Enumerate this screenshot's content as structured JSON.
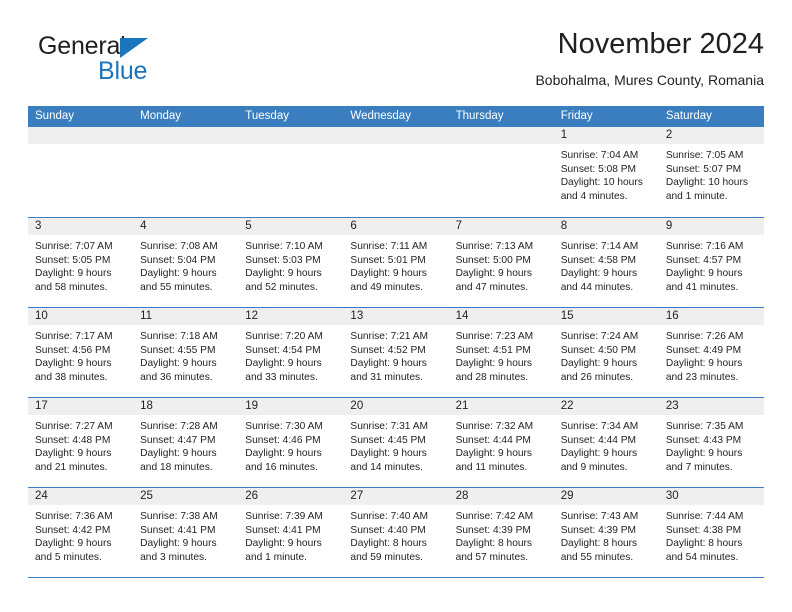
{
  "brand": {
    "word_one": "General",
    "word_two": "Blue",
    "triangle_icon": "triangle-icon",
    "accent_color": "#1b75bb"
  },
  "header": {
    "title": "November 2024",
    "subtitle": "Bobohalma, Mures County, Romania"
  },
  "theme": {
    "header_blue": "#3a7ebf",
    "day_number_band": "#efefef",
    "text_color": "#231f20"
  },
  "calendar": {
    "weekday_headers": [
      "Sunday",
      "Monday",
      "Tuesday",
      "Wednesday",
      "Thursday",
      "Friday",
      "Saturday"
    ],
    "weeks": [
      [
        {
          "day": "",
          "lines": []
        },
        {
          "day": "",
          "lines": []
        },
        {
          "day": "",
          "lines": []
        },
        {
          "day": "",
          "lines": []
        },
        {
          "day": "",
          "lines": []
        },
        {
          "day": "1",
          "lines": [
            "Sunrise: 7:04 AM",
            "Sunset: 5:08 PM",
            "Daylight: 10 hours",
            "and 4 minutes."
          ]
        },
        {
          "day": "2",
          "lines": [
            "Sunrise: 7:05 AM",
            "Sunset: 5:07 PM",
            "Daylight: 10 hours",
            "and 1 minute."
          ]
        }
      ],
      [
        {
          "day": "3",
          "lines": [
            "Sunrise: 7:07 AM",
            "Sunset: 5:05 PM",
            "Daylight: 9 hours",
            "and 58 minutes."
          ]
        },
        {
          "day": "4",
          "lines": [
            "Sunrise: 7:08 AM",
            "Sunset: 5:04 PM",
            "Daylight: 9 hours",
            "and 55 minutes."
          ]
        },
        {
          "day": "5",
          "lines": [
            "Sunrise: 7:10 AM",
            "Sunset: 5:03 PM",
            "Daylight: 9 hours",
            "and 52 minutes."
          ]
        },
        {
          "day": "6",
          "lines": [
            "Sunrise: 7:11 AM",
            "Sunset: 5:01 PM",
            "Daylight: 9 hours",
            "and 49 minutes."
          ]
        },
        {
          "day": "7",
          "lines": [
            "Sunrise: 7:13 AM",
            "Sunset: 5:00 PM",
            "Daylight: 9 hours",
            "and 47 minutes."
          ]
        },
        {
          "day": "8",
          "lines": [
            "Sunrise: 7:14 AM",
            "Sunset: 4:58 PM",
            "Daylight: 9 hours",
            "and 44 minutes."
          ]
        },
        {
          "day": "9",
          "lines": [
            "Sunrise: 7:16 AM",
            "Sunset: 4:57 PM",
            "Daylight: 9 hours",
            "and 41 minutes."
          ]
        }
      ],
      [
        {
          "day": "10",
          "lines": [
            "Sunrise: 7:17 AM",
            "Sunset: 4:56 PM",
            "Daylight: 9 hours",
            "and 38 minutes."
          ]
        },
        {
          "day": "11",
          "lines": [
            "Sunrise: 7:18 AM",
            "Sunset: 4:55 PM",
            "Daylight: 9 hours",
            "and 36 minutes."
          ]
        },
        {
          "day": "12",
          "lines": [
            "Sunrise: 7:20 AM",
            "Sunset: 4:54 PM",
            "Daylight: 9 hours",
            "and 33 minutes."
          ]
        },
        {
          "day": "13",
          "lines": [
            "Sunrise: 7:21 AM",
            "Sunset: 4:52 PM",
            "Daylight: 9 hours",
            "and 31 minutes."
          ]
        },
        {
          "day": "14",
          "lines": [
            "Sunrise: 7:23 AM",
            "Sunset: 4:51 PM",
            "Daylight: 9 hours",
            "and 28 minutes."
          ]
        },
        {
          "day": "15",
          "lines": [
            "Sunrise: 7:24 AM",
            "Sunset: 4:50 PM",
            "Daylight: 9 hours",
            "and 26 minutes."
          ]
        },
        {
          "day": "16",
          "lines": [
            "Sunrise: 7:26 AM",
            "Sunset: 4:49 PM",
            "Daylight: 9 hours",
            "and 23 minutes."
          ]
        }
      ],
      [
        {
          "day": "17",
          "lines": [
            "Sunrise: 7:27 AM",
            "Sunset: 4:48 PM",
            "Daylight: 9 hours",
            "and 21 minutes."
          ]
        },
        {
          "day": "18",
          "lines": [
            "Sunrise: 7:28 AM",
            "Sunset: 4:47 PM",
            "Daylight: 9 hours",
            "and 18 minutes."
          ]
        },
        {
          "day": "19",
          "lines": [
            "Sunrise: 7:30 AM",
            "Sunset: 4:46 PM",
            "Daylight: 9 hours",
            "and 16 minutes."
          ]
        },
        {
          "day": "20",
          "lines": [
            "Sunrise: 7:31 AM",
            "Sunset: 4:45 PM",
            "Daylight: 9 hours",
            "and 14 minutes."
          ]
        },
        {
          "day": "21",
          "lines": [
            "Sunrise: 7:32 AM",
            "Sunset: 4:44 PM",
            "Daylight: 9 hours",
            "and 11 minutes."
          ]
        },
        {
          "day": "22",
          "lines": [
            "Sunrise: 7:34 AM",
            "Sunset: 4:44 PM",
            "Daylight: 9 hours",
            "and 9 minutes."
          ]
        },
        {
          "day": "23",
          "lines": [
            "Sunrise: 7:35 AM",
            "Sunset: 4:43 PM",
            "Daylight: 9 hours",
            "and 7 minutes."
          ]
        }
      ],
      [
        {
          "day": "24",
          "lines": [
            "Sunrise: 7:36 AM",
            "Sunset: 4:42 PM",
            "Daylight: 9 hours",
            "and 5 minutes."
          ]
        },
        {
          "day": "25",
          "lines": [
            "Sunrise: 7:38 AM",
            "Sunset: 4:41 PM",
            "Daylight: 9 hours",
            "and 3 minutes."
          ]
        },
        {
          "day": "26",
          "lines": [
            "Sunrise: 7:39 AM",
            "Sunset: 4:41 PM",
            "Daylight: 9 hours",
            "and 1 minute."
          ]
        },
        {
          "day": "27",
          "lines": [
            "Sunrise: 7:40 AM",
            "Sunset: 4:40 PM",
            "Daylight: 8 hours",
            "and 59 minutes."
          ]
        },
        {
          "day": "28",
          "lines": [
            "Sunrise: 7:42 AM",
            "Sunset: 4:39 PM",
            "Daylight: 8 hours",
            "and 57 minutes."
          ]
        },
        {
          "day": "29",
          "lines": [
            "Sunrise: 7:43 AM",
            "Sunset: 4:39 PM",
            "Daylight: 8 hours",
            "and 55 minutes."
          ]
        },
        {
          "day": "30",
          "lines": [
            "Sunrise: 7:44 AM",
            "Sunset: 4:38 PM",
            "Daylight: 8 hours",
            "and 54 minutes."
          ]
        }
      ]
    ]
  }
}
